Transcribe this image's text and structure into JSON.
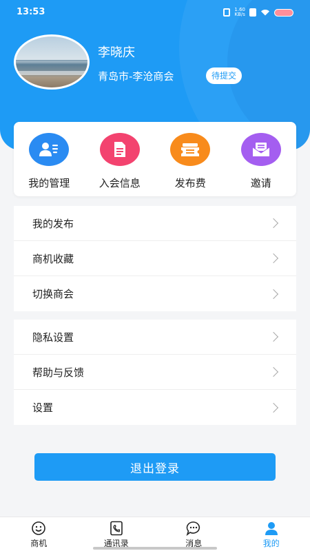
{
  "status_bar": {
    "time": "13:53",
    "net_speed_value": "1.60",
    "net_speed_unit": "KB/s",
    "icons": [
      "vibrate-icon",
      "nfc-icon",
      "wifi-icon",
      "battery-icon"
    ]
  },
  "profile": {
    "name": "李晓庆",
    "organization": "青岛市-李沧商会",
    "status_badge": "待提交"
  },
  "quick_actions": [
    {
      "label": "我的管理",
      "icon": "user-card-icon",
      "color": "#2a8bf2"
    },
    {
      "label": "入会信息",
      "icon": "document-icon",
      "color": "#f3436f"
    },
    {
      "label": "发布费",
      "icon": "ticket-icon",
      "color": "#f88b1c"
    },
    {
      "label": "邀请",
      "icon": "mail-icon",
      "color": "#a45ef0"
    }
  ],
  "menu_group_1": [
    {
      "label": "我的发布"
    },
    {
      "label": "商机收藏"
    },
    {
      "label": "切换商会"
    }
  ],
  "menu_group_2": [
    {
      "label": "隐私设置"
    },
    {
      "label": "帮助与反馈"
    },
    {
      "label": "设置"
    }
  ],
  "logout_label": "退出登录",
  "bottom_nav": [
    {
      "label": "商机",
      "icon": "smile-icon",
      "active": false
    },
    {
      "label": "通讯录",
      "icon": "contacts-icon",
      "active": false
    },
    {
      "label": "消息",
      "icon": "chat-icon",
      "active": false
    },
    {
      "label": "我的",
      "icon": "person-icon",
      "active": true
    }
  ],
  "colors": {
    "primary": "#1e9bf5",
    "background": "#f4f5f7"
  }
}
